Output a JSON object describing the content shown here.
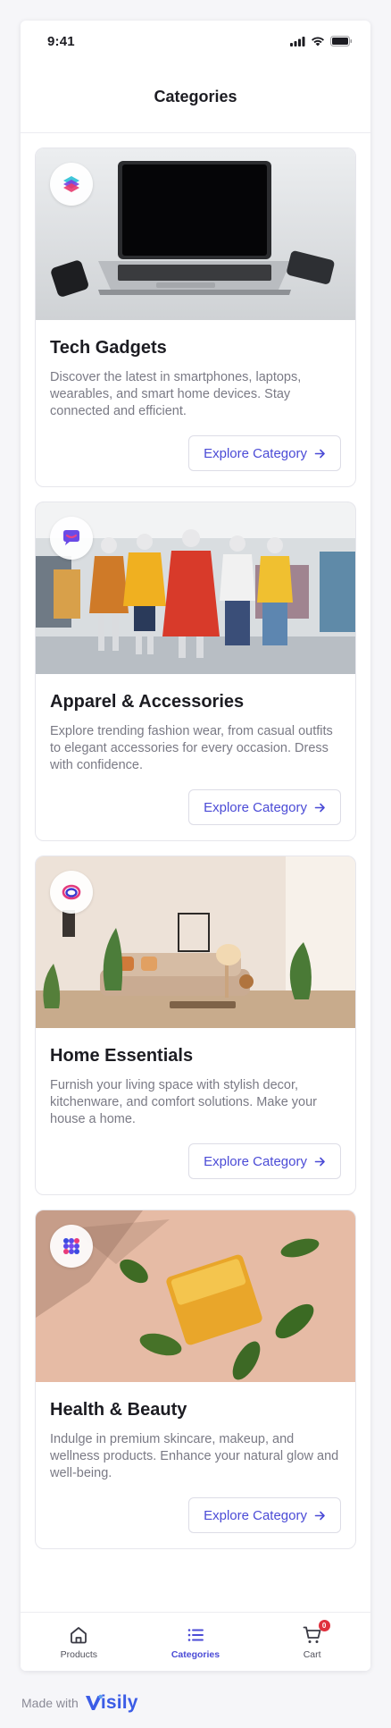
{
  "status_bar": {
    "time": "9:41",
    "icons": [
      "signal-icon",
      "wifi-icon",
      "battery-icon"
    ]
  },
  "header": {
    "title": "Categories"
  },
  "categories": [
    {
      "title": "Tech Gadgets",
      "description": "Discover the latest in smartphones, laptops, wearables, and smart home devices. Stay connected and efficient.",
      "button_label": "Explore Category",
      "icon": "layers-icon"
    },
    {
      "title": "Apparel & Accessories",
      "description": "Explore trending fashion wear, from casual outfits to elegant accessories for every occasion. Dress with confidence.",
      "button_label": "Explore Category",
      "icon": "chat-bubble-icon"
    },
    {
      "title": "Home Essentials",
      "description": "Furnish your living space with stylish decor, kitchenware, and comfort solutions. Make your house a home.",
      "button_label": "Explore Category",
      "icon": "ring-icon"
    },
    {
      "title": "Health & Beauty",
      "description": "Indulge in premium skincare, makeup, and wellness products. Enhance your natural glow and well-being.",
      "button_label": "Explore Category",
      "icon": "dots-grid-icon"
    }
  ],
  "tab_bar": {
    "tabs": [
      {
        "label": "Products",
        "icon": "home-icon",
        "active": false
      },
      {
        "label": "Categories",
        "icon": "list-icon",
        "active": true
      },
      {
        "label": "Cart",
        "icon": "cart-icon",
        "active": false,
        "badge": "0"
      }
    ]
  },
  "footer": {
    "made_with": "Made with",
    "brand_first": "V",
    "brand_rest": "isily"
  },
  "colors": {
    "accent": "#4b4bd6",
    "badge": "#e0303d",
    "brand": "#3b5ce6"
  }
}
